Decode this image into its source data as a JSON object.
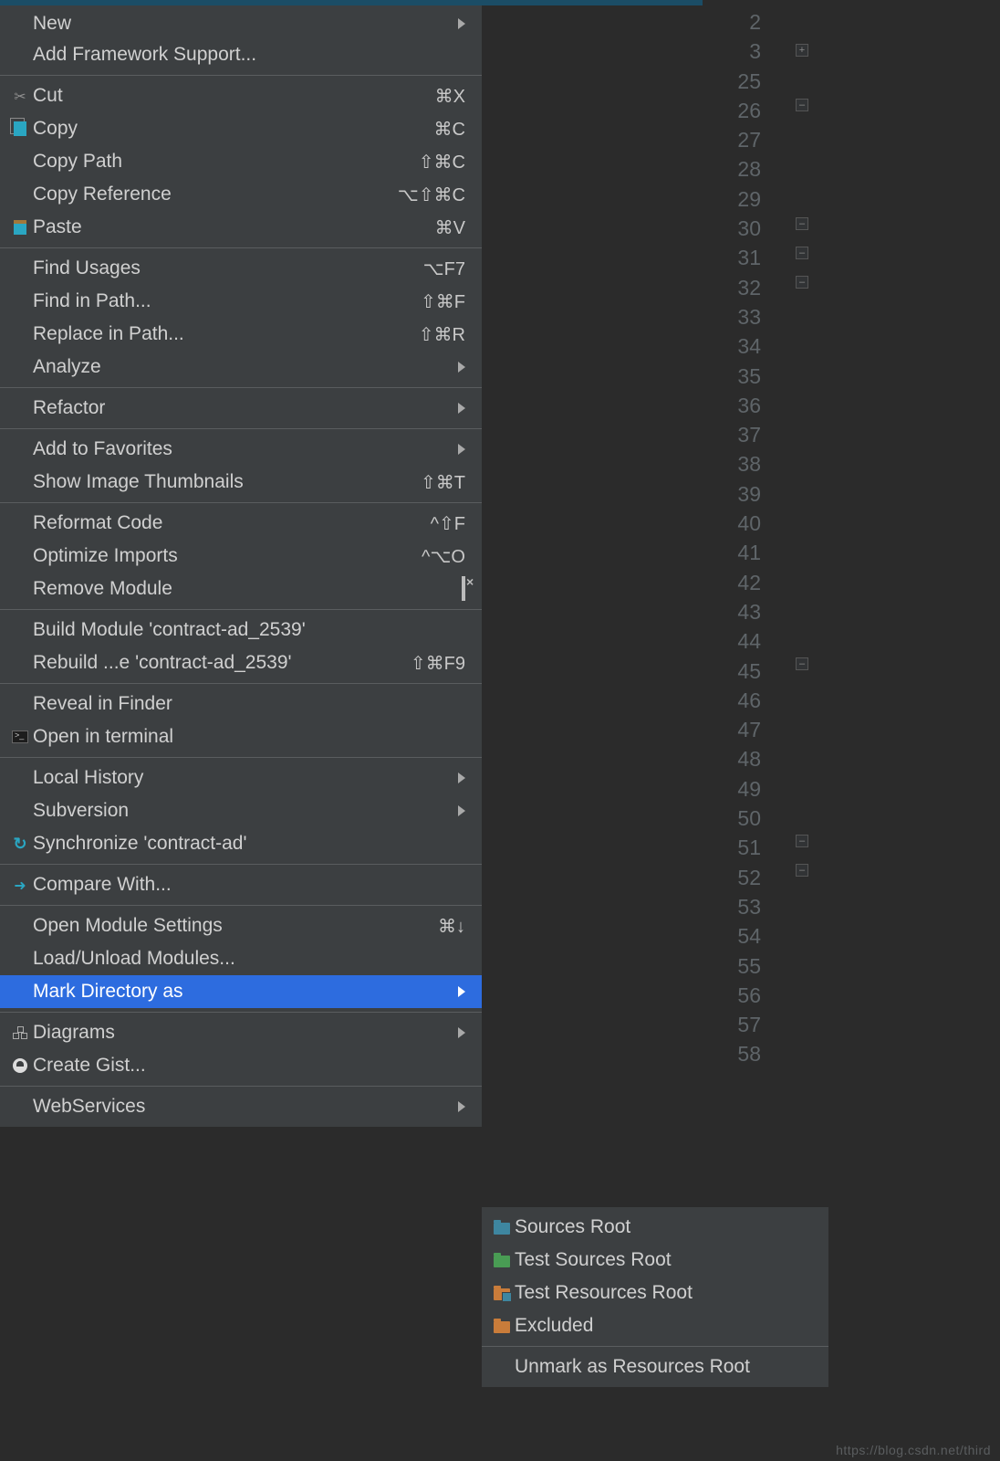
{
  "menu": {
    "groups": [
      [
        {
          "label": "New",
          "submenu": true
        },
        {
          "label": "Add Framework Support..."
        }
      ],
      [
        {
          "label": "Cut",
          "shortcut": "⌘X",
          "icon": "scissors"
        },
        {
          "label": "Copy",
          "shortcut": "⌘C",
          "icon": "copy"
        },
        {
          "label": "Copy Path",
          "shortcut": "⇧⌘C"
        },
        {
          "label": "Copy Reference",
          "shortcut": "⌥⇧⌘C"
        },
        {
          "label": "Paste",
          "shortcut": "⌘V",
          "icon": "paste"
        }
      ],
      [
        {
          "label": "Find Usages",
          "shortcut": "⌥F7"
        },
        {
          "label": "Find in Path...",
          "shortcut": "⇧⌘F"
        },
        {
          "label": "Replace in Path...",
          "shortcut": "⇧⌘R"
        },
        {
          "label": "Analyze",
          "submenu": true
        }
      ],
      [
        {
          "label": "Refactor",
          "submenu": true
        }
      ],
      [
        {
          "label": "Add to Favorites",
          "submenu": true
        },
        {
          "label": "Show Image Thumbnails",
          "shortcut": "⇧⌘T"
        }
      ],
      [
        {
          "label": "Reformat Code",
          "shortcut": "^⇧F"
        },
        {
          "label": "Optimize Imports",
          "shortcut": "^⌥O"
        },
        {
          "label": "Remove Module",
          "icon": "remove"
        }
      ],
      [
        {
          "label": "Build Module 'contract-ad_2539'"
        },
        {
          "label": "Rebuild ...e 'contract-ad_2539'",
          "shortcut": "⇧⌘F9"
        }
      ],
      [
        {
          "label": "Reveal in Finder"
        },
        {
          "label": "Open in terminal",
          "icon": "terminal"
        }
      ],
      [
        {
          "label": "Local History",
          "submenu": true
        },
        {
          "label": "Subversion",
          "submenu": true
        },
        {
          "label": "Synchronize 'contract-ad'",
          "icon": "sync"
        }
      ],
      [
        {
          "label": "Compare With...",
          "icon": "compare"
        }
      ],
      [
        {
          "label": "Open Module Settings",
          "shortcut": "⌘↓"
        },
        {
          "label": "Load/Unload Modules..."
        },
        {
          "label": "Mark Directory as",
          "submenu": true,
          "highlight": true
        }
      ],
      [
        {
          "label": "Diagrams",
          "submenu": true,
          "icon": "diagram"
        },
        {
          "label": "Create Gist...",
          "icon": "gist"
        }
      ],
      [
        {
          "label": "WebServices",
          "submenu": true
        }
      ]
    ]
  },
  "submenu": {
    "items": [
      {
        "label": "Sources Root",
        "folder": "blue"
      },
      {
        "label": "Test Sources Root",
        "folder": "green"
      },
      {
        "label": "Test Resources Root",
        "folder": "testres"
      },
      {
        "label": "Excluded",
        "folder": "orange"
      }
    ],
    "unmark": "Unmark as Resources Root"
  },
  "gutter": {
    "lines": [
      2,
      3,
      25,
      26,
      27,
      28,
      29,
      30,
      31,
      32,
      33,
      34,
      35,
      36,
      37,
      38,
      39,
      40,
      41,
      42,
      43,
      44,
      45,
      46,
      47,
      48,
      49,
      50,
      51,
      52,
      53,
      54,
      55,
      56,
      57,
      58
    ]
  },
  "watermark": "https://blog.csdn.net/third"
}
